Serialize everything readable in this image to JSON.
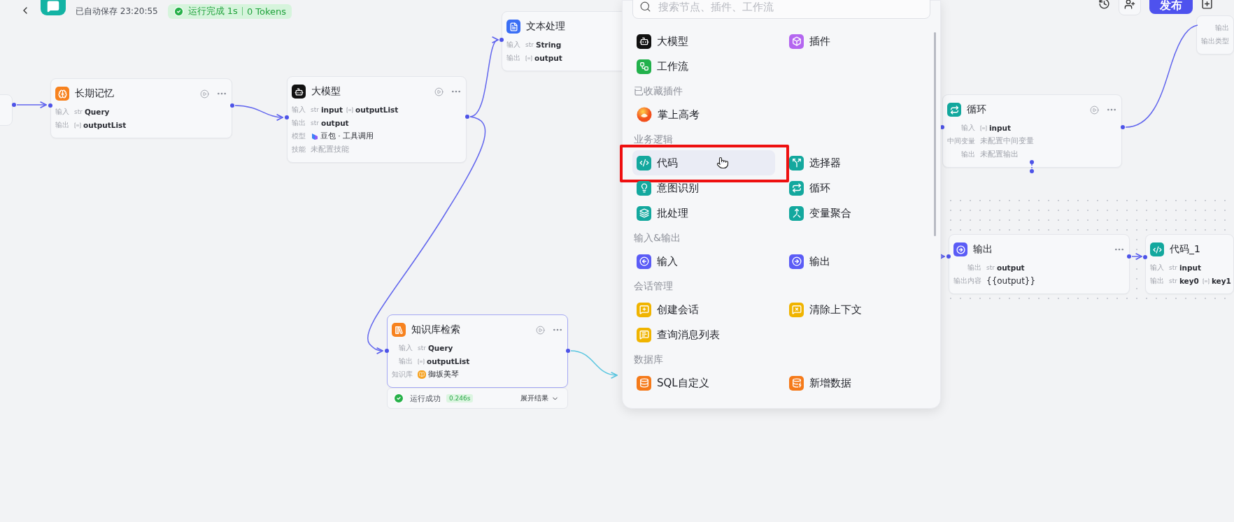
{
  "header": {
    "save_status": "已自动保存 23:20:55",
    "run_status": "运行完成 1s",
    "tokens": "0 Tokens",
    "publish_button": "发布"
  },
  "nodes": [
    {
      "kind": "memory",
      "title": "长期记忆",
      "color": "#f7821f",
      "selected": false,
      "run_button": true,
      "more_button": true,
      "rows": [
        {
          "label": "输入",
          "values": [
            {
              "kind": "str",
              "tag": "str",
              "text": "Query"
            }
          ]
        },
        {
          "label": "输出",
          "values": [
            {
              "kind": "array",
              "text": "outputList"
            }
          ]
        }
      ]
    },
    {
      "kind": "llm",
      "title": "大模型",
      "color": "#111111",
      "selected": false,
      "run_button": true,
      "more_button": true,
      "rows": [
        {
          "label": "输入",
          "values": [
            {
              "kind": "str",
              "tag": "str",
              "text": "input"
            },
            {
              "kind": "array",
              "text": "outputList"
            }
          ]
        },
        {
          "label": "输出",
          "values": [
            {
              "kind": "str",
              "tag": "str",
              "text": "output"
            }
          ]
        },
        {
          "label": "模型",
          "values": [
            {
              "kind": "model",
              "text": "豆包 · 工具调用"
            }
          ]
        },
        {
          "label": "技能",
          "values": [
            {
              "kind": "plain",
              "text": "未配置技能"
            }
          ]
        }
      ]
    },
    {
      "kind": "text",
      "title": "文本处理",
      "color": "#3b6ff5",
      "selected": false,
      "run_button": false,
      "more_button": false,
      "rows": [
        {
          "label": "输入",
          "values": [
            {
              "kind": "str",
              "tag": "str",
              "text": "String"
            }
          ]
        },
        {
          "label": "输出",
          "values": [
            {
              "kind": "array",
              "text": "output"
            }
          ]
        }
      ]
    },
    {
      "kind": "loop",
      "title": "循环",
      "color": "#13a89e",
      "selected": false,
      "run_button": true,
      "more_button": true,
      "rows": [
        {
          "label": "输入",
          "values": [
            {
              "kind": "array",
              "text": "input"
            }
          ]
        },
        {
          "label": "中间变量",
          "values": [
            {
              "kind": "plain",
              "text": "未配置中间变量"
            }
          ]
        },
        {
          "label": "输出",
          "values": [
            {
              "kind": "plain",
              "text": "未配置输出"
            }
          ]
        }
      ]
    },
    {
      "kind": "output",
      "title": "输出",
      "color": "#5b5cf6",
      "selected": false,
      "run_button": false,
      "more_button": true,
      "rows": [
        {
          "label": "输出",
          "values": [
            {
              "kind": "str",
              "tag": "str",
              "text": "output"
            }
          ]
        },
        {
          "label": "输出内容",
          "values": [
            {
              "kind": "template",
              "text": "{{output}}"
            }
          ]
        }
      ]
    },
    {
      "kind": "code",
      "title": "代码_1",
      "color": "#13a89e",
      "selected": false,
      "run_button": false,
      "more_button": false,
      "rows": [
        {
          "label": "输入",
          "values": [
            {
              "kind": "str",
              "tag": "str",
              "text": "input"
            }
          ]
        },
        {
          "label": "输出",
          "values": [
            {
              "kind": "str",
              "tag": "str",
              "text": "key0"
            },
            {
              "kind": "array",
              "text": "key1"
            }
          ]
        }
      ]
    },
    {
      "kind": "kb",
      "title": "知识库检索",
      "color": "#f7821f",
      "selected": true,
      "run_button": true,
      "more_button": true,
      "rows": [
        {
          "label": "输入",
          "values": [
            {
              "kind": "str",
              "tag": "str",
              "text": "Query"
            }
          ]
        },
        {
          "label": "输出",
          "values": [
            {
              "kind": "array",
              "text": "outputList"
            }
          ]
        },
        {
          "label": "知识库",
          "values": [
            {
              "kind": "kb",
              "text": "御坂美琴"
            }
          ]
        }
      ]
    },
    {
      "kind": "fragment",
      "selected": false,
      "rows": [
        {
          "label": "输出",
          "values": []
        },
        {
          "label": "输出类型",
          "values": []
        }
      ]
    }
  ],
  "run_result": {
    "status": "运行成功",
    "time": "0.246s",
    "toggle": "展开结果"
  },
  "node_menu": {
    "search": {
      "placeholder": "搜索节点、插件、工作流"
    },
    "sections": [
      {
        "items": [
          {
            "kind": "llm",
            "label": "大模型",
            "color": "#111111",
            "selected": false
          },
          {
            "kind": "plugin",
            "label": "插件",
            "color": "#b466f0",
            "selected": false
          },
          {
            "kind": "workflow",
            "label": "工作流",
            "color": "#22b14c",
            "selected": false
          }
        ]
      },
      {
        "title": "已收藏插件",
        "items": [
          {
            "kind": "favorite",
            "label": "掌上高考",
            "selected": false
          }
        ]
      },
      {
        "title": "业务逻辑",
        "items": [
          {
            "kind": "code",
            "label": "代码",
            "color": "#13a89e",
            "selected": true
          },
          {
            "kind": "condition",
            "label": "选择器",
            "color": "#13a89e",
            "selected": false
          },
          {
            "kind": "intent",
            "label": "意图识别",
            "color": "#13a89e",
            "selected": false
          },
          {
            "kind": "loop",
            "label": "循环",
            "color": "#13a89e",
            "selected": false
          },
          {
            "kind": "batch",
            "label": "批处理",
            "color": "#13a89e",
            "selected": false
          },
          {
            "kind": "aggregate",
            "label": "变量聚合",
            "color": "#13a89e",
            "selected": false
          }
        ]
      },
      {
        "title": "输入&输出",
        "items": [
          {
            "kind": "input",
            "label": "输入",
            "color": "#5b5cf6",
            "selected": false
          },
          {
            "kind": "output",
            "label": "输出",
            "color": "#5b5cf6",
            "selected": false
          }
        ]
      },
      {
        "title": "会话管理",
        "items": [
          {
            "kind": "create_conv",
            "label": "创建会话",
            "color": "#f0b400",
            "selected": false
          },
          {
            "kind": "clear_ctx",
            "label": "清除上下文",
            "color": "#f0b400",
            "selected": false
          },
          {
            "kind": "query_msgs",
            "label": "查询消息列表",
            "color": "#f0b400",
            "selected": false
          }
        ]
      },
      {
        "title": "数据库",
        "items": [
          {
            "kind": "sql",
            "label": "SQL自定义",
            "color": "#f57a1a",
            "selected": false
          },
          {
            "kind": "insert",
            "label": "新增数据",
            "color": "#f57a1a",
            "selected": false
          }
        ]
      }
    ]
  }
}
